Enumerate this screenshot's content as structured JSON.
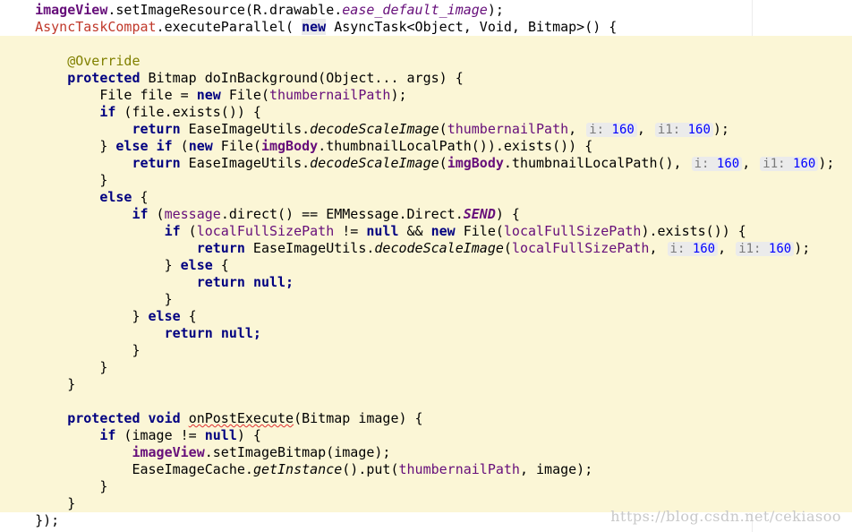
{
  "code": {
    "imageView": "imageView",
    "setImageResource": ".setImageResource(R.drawable.",
    "ease_default_image": "ease_default_image",
    "close_paren_semi": ");",
    "AsyncTaskCompat": "AsyncTaskCompat",
    "executeParallel": ".executeParallel( ",
    "new": "new",
    "asyncTaskGeneric": " AsyncTask<Object, Void, Bitmap>() {",
    "override": "@Override",
    "protected": "protected",
    "doInBackgroundSig": " Bitmap doInBackground(Object... args) {",
    "fileDecl": "File file = ",
    "FileOpen": " File(",
    "thumbernailPath": "thumbernailPath",
    "closeSemi": ");",
    "if": "if",
    "fileExists": " (file.exists()) {",
    "return": "return",
    "easeImageUtils": " EaseImageUtils.",
    "decodeScaleImage": "decodeScaleImage",
    "openParen": "(",
    "comma": ", ",
    "hint_i": "i:",
    "hint_i1": "i1:",
    "val160": "160",
    "closeBrace": "}",
    "else": "else",
    "elseIf": "} else if (",
    "newFileOpen": " File(",
    "imgBody": "imgBody",
    "thumbLocalPath": ".thumbnailLocalPath()).exists()) {",
    "thumbLocalPathCall": ".thumbnailLocalPath(), ",
    "elseOpen": " {",
    "message": "message",
    "directCheck": ".direct() == EMMessage.Direct.",
    "SEND": "SEND",
    "closeParenBrace": ") {",
    "localFullSizePath": "localFullSizePath",
    "notEq": " != ",
    "null": "null",
    "andAnd": " && ",
    "existsBrace": ").exists()) {",
    "elseBlockOpen": "} else {",
    "returnNull": "null;",
    "void": "void",
    "onPostExecute": "onPostExecute",
    "onPostSig": "(Bitmap image) {",
    "imageNotNull": " (image != ",
    "nullBrace": ") {",
    "setImageBitmap": ".setImageBitmap(image);",
    "easeImageCache": "EaseImageCache.",
    "getInstance": "getInstance",
    "putCall": "().put(",
    "imageClose": ", image);",
    "endCall": "});"
  },
  "watermark": "https://blog.csdn.net/cekiasoo"
}
